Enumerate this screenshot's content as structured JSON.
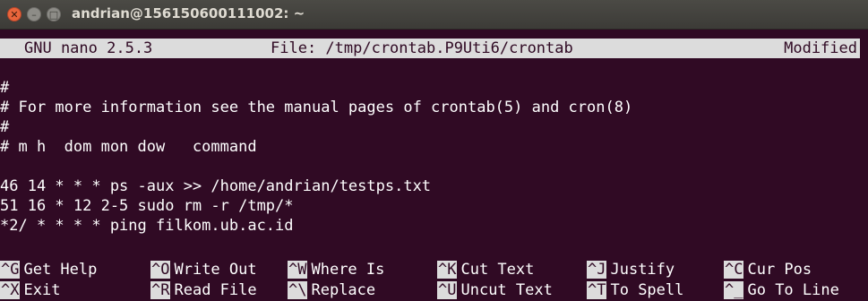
{
  "window": {
    "title": "andrian@156150600111002: ~",
    "close_glyph": "✕",
    "min_glyph": "–",
    "max_glyph": "□"
  },
  "nano_header": {
    "version": "GNU nano 2.5.3",
    "file": "File: /tmp/crontab.P9Uti6/crontab",
    "status": "Modified"
  },
  "editor_lines": [
    "#",
    "# For more information see the manual pages of crontab(5) and cron(8)",
    "#",
    "# m h  dom mon dow   command",
    "",
    "46 14 * * * ps -aux >> /home/andrian/testps.txt",
    "51 16 * 12 2-5 sudo rm -r /tmp/*",
    "*2/ * * * * ping filkom.ub.ac.id"
  ],
  "shortcuts": [
    {
      "key": "^G",
      "label": "Get Help"
    },
    {
      "key": "^O",
      "label": "Write Out"
    },
    {
      "key": "^W",
      "label": "Where Is"
    },
    {
      "key": "^K",
      "label": "Cut Text"
    },
    {
      "key": "^J",
      "label": "Justify"
    },
    {
      "key": "^C",
      "label": "Cur Pos"
    },
    {
      "key": "^X",
      "label": "Exit"
    },
    {
      "key": "^R",
      "label": "Read File"
    },
    {
      "key": "^\\",
      "label": "Replace"
    },
    {
      "key": "^U",
      "label": "Uncut Text"
    },
    {
      "key": "^T",
      "label": "To Spell"
    },
    {
      "key": "^_",
      "label": "Go To Line"
    }
  ],
  "colors": {
    "terminal_bg": "#300a24",
    "titlebar_bg": "#3c3b37",
    "inverse_bg": "#dcdcdc",
    "close_button": "#e9653b"
  }
}
